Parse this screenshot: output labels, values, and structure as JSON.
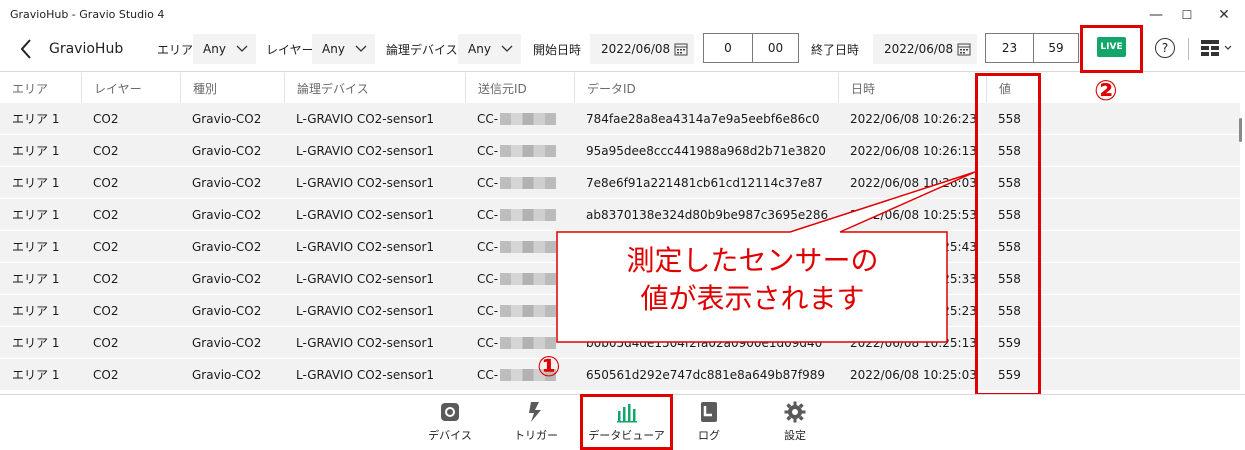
{
  "window": {
    "title": "GravioHub - Gravio Studio 4",
    "controls": [
      "—",
      "☐",
      "✕"
    ]
  },
  "toolbar": {
    "app_name": "GravioHub",
    "area_label": "エリア",
    "area_value": "Any",
    "layer_label": "レイヤー",
    "layer_value": "Any",
    "device_label": "論理デバイス",
    "device_value": "Any",
    "start_label": "開始日時",
    "start_date": "2022/06/08",
    "start_hour": "0",
    "start_min": "00",
    "end_label": "終了日時",
    "end_date": "2022/06/08",
    "end_hour": "23",
    "end_min": "59",
    "live_label": "LIVE",
    "help_label": "?",
    "accent_live": "#12a66a"
  },
  "table": {
    "headers": [
      "エリア",
      "レイヤー",
      "種別",
      "論理デバイス",
      "送信元ID",
      "データID",
      "日時",
      "値"
    ],
    "rows": [
      [
        "エリア 1",
        "CO2",
        "Gravio-CO2",
        "L-GRAVIO CO2-sensor1",
        "CC-",
        "784fae28a8ea4314a7e9a5eebf6e86c0",
        "2022/06/08 10:26:23",
        "558"
      ],
      [
        "エリア 1",
        "CO2",
        "Gravio-CO2",
        "L-GRAVIO CO2-sensor1",
        "CC-",
        "95a95dee8ccc441988a968d2b71e3820",
        "2022/06/08 10:26:13",
        "558"
      ],
      [
        "エリア 1",
        "CO2",
        "Gravio-CO2",
        "L-GRAVIO CO2-sensor1",
        "CC-",
        "7e8e6f91a221481cb61cd12114c37e87",
        "2022/06/08 10:26:03",
        "558"
      ],
      [
        "エリア 1",
        "CO2",
        "Gravio-CO2",
        "L-GRAVIO CO2-sensor1",
        "CC-",
        "ab8370138e324d80b9be987c3695e286",
        "2022/06/08 10:25:53",
        "558"
      ],
      [
        "エリア 1",
        "CO2",
        "Gravio-CO2",
        "L-GRAVIO CO2-sensor1",
        "CC-",
        "",
        "2022/06/08 10:25:43",
        "558"
      ],
      [
        "エリア 1",
        "CO2",
        "Gravio-CO2",
        "L-GRAVIO CO2-sensor1",
        "CC-",
        "",
        "2022/06/08 10:25:33",
        "558"
      ],
      [
        "エリア 1",
        "CO2",
        "Gravio-CO2",
        "L-GRAVIO CO2-sensor1",
        "CC-",
        "",
        "2022/06/08 10:25:23",
        "558"
      ],
      [
        "エリア 1",
        "CO2",
        "Gravio-CO2",
        "L-GRAVIO CO2-sensor1",
        "CC-",
        "b0b05d4de1504f2fa02a0900e1d09d40",
        "2022/06/08 10:25:13",
        "559"
      ],
      [
        "エリア 1",
        "CO2",
        "Gravio-CO2",
        "L-GRAVIO CO2-sensor1",
        "CC-",
        "650561d292e747dc881e8a649b87f989",
        "2022/06/08 10:25:03",
        "559"
      ]
    ]
  },
  "bottom_nav": {
    "items": [
      {
        "label": "デバイス",
        "icon": "gear-icon"
      },
      {
        "label": "トリガー",
        "icon": "trigger-icon"
      },
      {
        "label": "データビューア",
        "icon": "bar-chart-icon"
      },
      {
        "label": "ログ",
        "icon": "log-icon"
      },
      {
        "label": "設定",
        "icon": "settings-icon"
      }
    ],
    "active_color": "#12a66a"
  },
  "annotation": {
    "callout_line1": "測定したセンサーの",
    "callout_line2": "値が表示されます",
    "marker1": "①",
    "marker2": "②",
    "color": "#e00000"
  }
}
